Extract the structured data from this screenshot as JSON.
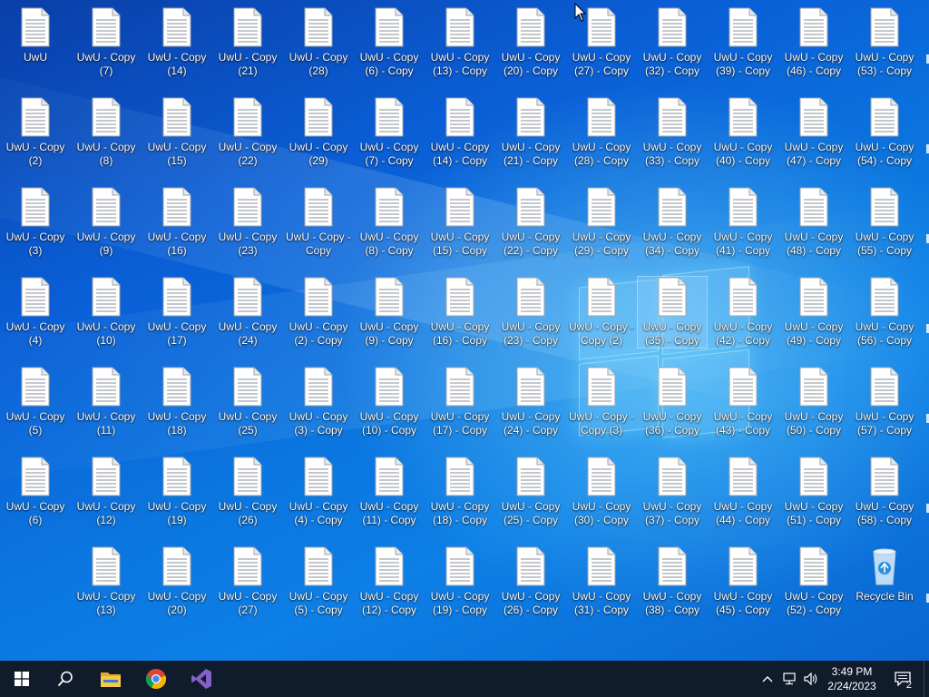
{
  "desktop": {
    "columns": [
      [
        "UwU",
        "UwU - Copy (2)",
        "UwU - Copy (3)",
        "UwU - Copy (4)",
        "UwU - Copy (5)",
        "UwU - Copy (6)"
      ],
      [
        "UwU - Copy (7)",
        "UwU - Copy (8)",
        "UwU - Copy (9)",
        "UwU - Copy (10)",
        "UwU - Copy (11)",
        "UwU - Copy (12)",
        "UwU - Copy (13)"
      ],
      [
        "UwU - Copy (14)",
        "UwU - Copy (15)",
        "UwU - Copy (16)",
        "UwU - Copy (17)",
        "UwU - Copy (18)",
        "UwU - Copy (19)",
        "UwU - Copy (20)"
      ],
      [
        "UwU - Copy (21)",
        "UwU - Copy (22)",
        "UwU - Copy (23)",
        "UwU - Copy (24)",
        "UwU - Copy (25)",
        "UwU - Copy (26)",
        "UwU - Copy (27)"
      ],
      [
        "UwU - Copy (28)",
        "UwU - Copy (29)",
        "UwU - Copy - Copy",
        "UwU - Copy (2) - Copy",
        "UwU - Copy (3) - Copy",
        "UwU - Copy (4) - Copy",
        "UwU - Copy (5) - Copy"
      ],
      [
        "UwU - Copy (6) - Copy",
        "UwU - Copy (7) - Copy",
        "UwU - Copy (8) - Copy",
        "UwU - Copy (9) - Copy",
        "UwU - Copy (10) - Copy",
        "UwU - Copy (11) - Copy",
        "UwU - Copy (12) - Copy"
      ],
      [
        "UwU - Copy (13) - Copy",
        "UwU - Copy (14) - Copy",
        "UwU - Copy (15) - Copy",
        "UwU - Copy (16) - Copy",
        "UwU - Copy (17) - Copy",
        "UwU - Copy (18) - Copy",
        "UwU - Copy (19) - Copy"
      ],
      [
        "UwU - Copy (20) - Copy",
        "UwU - Copy (21) - Copy",
        "UwU - Copy (22) - Copy",
        "UwU - Copy (23) - Copy",
        "UwU - Copy (24) - Copy",
        "UwU - Copy (25) - Copy",
        "UwU - Copy (26) - Copy"
      ],
      [
        "UwU - Copy (27) - Copy",
        "UwU - Copy (28) - Copy",
        "UwU - Copy (29) - Copy",
        "UwU - Copy - Copy (2)",
        "UwU - Copy - Copy (3)",
        "UwU - Copy (30) - Copy",
        "UwU - Copy (31) - Copy"
      ],
      [
        "UwU - Copy (32) - Copy",
        "UwU - Copy (33) - Copy",
        "UwU - Copy (34) - Copy",
        "UwU - Copy (35) - Copy",
        "UwU - Copy (36) - Copy",
        "UwU - Copy (37) - Copy",
        "UwU - Copy (38) - Copy"
      ],
      [
        "UwU - Copy (39) - Copy",
        "UwU - Copy (40) - Copy",
        "UwU - Copy (41) - Copy",
        "UwU - Copy (42) - Copy",
        "UwU - Copy (43) - Copy",
        "UwU - Copy (44) - Copy",
        "UwU - Copy (45) - Copy"
      ],
      [
        "UwU - Copy (46) - Copy",
        "UwU - Copy (47) - Copy",
        "UwU - Copy (48) - Copy",
        "UwU - Copy (49) - Copy",
        "UwU - Copy (50) - Copy",
        "UwU - Copy (51) - Copy",
        "UwU - Copy (52) - Copy"
      ],
      [
        "UwU - Copy (53) - Copy",
        "UwU - Copy (54) - Copy",
        "UwU - Copy (55) - Copy",
        "UwU - Copy (56) - Copy",
        "UwU - Copy (57) - Copy",
        "UwU - Copy (58) - Copy",
        "Recycle Bin"
      ]
    ],
    "selected_label": "UwU - Copy (35) - Copy",
    "file_icon": "text-file-icon",
    "bin_icon": "recycle-bin-icon"
  },
  "taskbar": {
    "items": [
      {
        "name": "start-button",
        "icon": "windows-logo-icon"
      },
      {
        "name": "search-button",
        "icon": "search-icon"
      },
      {
        "name": "file-explorer-button",
        "icon": "folder-icon"
      },
      {
        "name": "chrome-button",
        "icon": "chrome-icon"
      },
      {
        "name": "visual-studio-button",
        "icon": "visual-studio-icon"
      }
    ],
    "tray": {
      "time": "3:49 PM",
      "date": "2/24/2023",
      "notification_count": "2"
    }
  },
  "colors": {
    "taskbar": "#101b2b",
    "desktop_accent": "#0b76e0"
  }
}
